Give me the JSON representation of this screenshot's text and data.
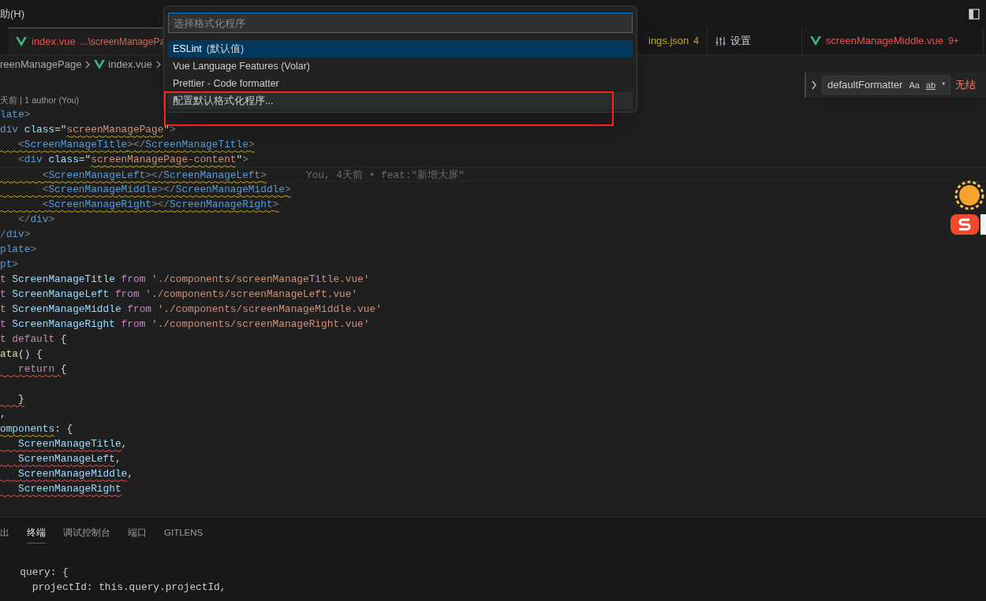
{
  "menu": {
    "label": "助(H)"
  },
  "tabs": [
    {
      "name": "index.vue",
      "path": "...\\screenManagePa",
      "kind": "vue",
      "color": "#f14c4c",
      "selected": true
    },
    {
      "name": "ings.json",
      "badge": "4",
      "kind": "json",
      "color": "#cca700",
      "selected": false
    },
    {
      "name": "设置",
      "kind": "settings",
      "color": "#cccccc",
      "selected": false
    },
    {
      "name": "screenManageMiddle.vue",
      "badge": "9+",
      "kind": "vue",
      "color": "#f14c4c",
      "selected": false
    }
  ],
  "breadcrumb": [
    {
      "label": "reenManagePage",
      "kind": "folder"
    },
    {
      "label": "index.vue",
      "kind": "vue"
    }
  ],
  "code_lens": "天前 | 1 author (You)",
  "code_lines": [
    {
      "kind": "code",
      "tokens": [
        {
          "kind": "tag",
          "text": "late"
        },
        {
          "kind": "punct",
          "text": ">"
        }
      ]
    },
    {
      "kind": "code",
      "tokens": [
        {
          "kind": "tag",
          "text": "div"
        },
        {
          "kind": "attr",
          "text": " class"
        },
        {
          "kind": "plain",
          "text": "=\""
        },
        {
          "kind": "string",
          "text": "screenManagePage",
          "color": "#cca700"
        },
        {
          "kind": "plain",
          "text": "\""
        },
        {
          "kind": "punct",
          "text": ">"
        }
      ]
    },
    {
      "kind": "code",
      "tokens": [
        {
          "kind": "punct",
          "text": "   <",
          "color": "#cca700"
        },
        {
          "kind": "tag",
          "text": "ScreenManageTitle",
          "color": "#cca700"
        },
        {
          "kind": "punct",
          "text": "></",
          "color": "#cca700"
        },
        {
          "kind": "tag",
          "text": "ScreenManageTitle",
          "color": "#cca700"
        },
        {
          "kind": "punct",
          "text": ">",
          "color": "#cca700"
        }
      ]
    },
    {
      "kind": "code",
      "tokens": [
        {
          "kind": "punct",
          "text": "   <"
        },
        {
          "kind": "tag",
          "text": "div"
        },
        {
          "kind": "attr",
          "text": " class"
        },
        {
          "kind": "plain",
          "text": "=\""
        },
        {
          "kind": "string",
          "text": "screenManagePage-content",
          "color": "#cca700"
        },
        {
          "kind": "plain",
          "text": "\""
        },
        {
          "kind": "punct",
          "text": ">"
        }
      ]
    },
    {
      "kind": "code",
      "blame": "You, 4天前 • feat:\"新增大屏\"",
      "tokens": [
        {
          "kind": "punct",
          "text": "       <",
          "color": "#cca700"
        },
        {
          "kind": "tag",
          "text": "ScreenManageLeft",
          "color": "#cca700"
        },
        {
          "kind": "punct",
          "text": "></",
          "color": "#cca700"
        },
        {
          "kind": "tag",
          "text": "ScreenManageLeft",
          "color": "#cca700"
        },
        {
          "kind": "punct",
          "text": ">",
          "color": "#cca700"
        }
      ]
    },
    {
      "kind": "code",
      "tokens": [
        {
          "kind": "punct",
          "text": "       <",
          "color": "#cca700"
        },
        {
          "kind": "tag",
          "text": "ScreenManageMiddle",
          "color": "#cca700"
        },
        {
          "kind": "punct",
          "text": "></",
          "color": "#cca700"
        },
        {
          "kind": "tag",
          "text": "ScreenManageMiddle",
          "color": "#cca700"
        },
        {
          "kind": "punct",
          "text": ">",
          "color": "#cca700"
        }
      ]
    },
    {
      "kind": "code",
      "tokens": [
        {
          "kind": "punct",
          "text": "       <",
          "color": "#cca700"
        },
        {
          "kind": "tag",
          "text": "ScreenManageRight",
          "color": "#cca700"
        },
        {
          "kind": "punct",
          "text": "></",
          "color": "#cca700"
        },
        {
          "kind": "tag",
          "text": "ScreenManageRight",
          "color": "#cca700"
        },
        {
          "kind": "punct",
          "text": ">",
          "color": "#cca700"
        }
      ]
    },
    {
      "kind": "code",
      "tokens": [
        {
          "kind": "punct",
          "text": "   </"
        },
        {
          "kind": "tag",
          "text": "div"
        },
        {
          "kind": "punct",
          "text": ">"
        }
      ]
    },
    {
      "kind": "code",
      "tokens": [
        {
          "kind": "punct",
          "text": "/"
        },
        {
          "kind": "tag",
          "text": "div"
        },
        {
          "kind": "punct",
          "text": ">"
        }
      ]
    },
    {
      "kind": "code",
      "tokens": [
        {
          "kind": "tag",
          "text": "plate"
        },
        {
          "kind": "punct",
          "text": ">"
        }
      ]
    },
    {
      "kind": "code",
      "tokens": [
        {
          "kind": "tag",
          "text": "pt"
        },
        {
          "kind": "punct",
          "text": ">"
        }
      ]
    },
    {
      "kind": "code",
      "tokens": [
        {
          "kind": "keyword",
          "text": "t "
        },
        {
          "kind": "ident",
          "text": "ScreenManageTitle "
        },
        {
          "kind": "keyword",
          "text": "from "
        },
        {
          "kind": "string",
          "text": "'./components/screenManageTitle.vue'"
        }
      ]
    },
    {
      "kind": "code",
      "tokens": [
        {
          "kind": "keyword",
          "text": "t "
        },
        {
          "kind": "ident",
          "text": "ScreenManageLeft "
        },
        {
          "kind": "keyword",
          "text": "from "
        },
        {
          "kind": "string",
          "text": "'./components/screenManageLeft.vue'"
        }
      ]
    },
    {
      "kind": "code",
      "tokens": [
        {
          "kind": "keyword",
          "text": "t "
        },
        {
          "kind": "ident",
          "text": "ScreenManageMiddle "
        },
        {
          "kind": "keyword",
          "text": "from "
        },
        {
          "kind": "string",
          "text": "'./components/screenManageMiddle.vue'"
        }
      ]
    },
    {
      "kind": "code",
      "tokens": [
        {
          "kind": "keyword",
          "text": "t "
        },
        {
          "kind": "ident",
          "text": "ScreenManageRight "
        },
        {
          "kind": "keyword",
          "text": "from "
        },
        {
          "kind": "string",
          "text": "'./components/screenManageRight.vue'"
        }
      ]
    },
    {
      "kind": "code",
      "tokens": [
        {
          "kind": "keyword",
          "text": "t default "
        },
        {
          "kind": "plain",
          "text": "{"
        }
      ]
    },
    {
      "kind": "code",
      "tokens": [
        {
          "kind": "func",
          "text": "ata"
        },
        {
          "kind": "plain",
          "text": "() {"
        }
      ]
    },
    {
      "kind": "code",
      "tokens": [
        {
          "kind": "keyword",
          "text": "   return ",
          "color": "#f14c4c"
        },
        {
          "kind": "plain",
          "text": "{"
        }
      ]
    },
    {
      "kind": "blank"
    },
    {
      "kind": "code",
      "tokens": [
        {
          "kind": "plain",
          "text": "   }",
          "color": "#f14c4c"
        }
      ]
    },
    {
      "kind": "code",
      "tokens": [
        {
          "kind": "plain",
          "text": ","
        }
      ]
    },
    {
      "kind": "code",
      "tokens": [
        {
          "kind": "ident",
          "text": "omponents",
          "color": "#cca700"
        },
        {
          "kind": "plain",
          "text": ": {"
        }
      ]
    },
    {
      "kind": "code",
      "tokens": [
        {
          "kind": "ident",
          "text": "   ScreenManageTitle",
          "color": "#f14c4c"
        },
        {
          "kind": "plain",
          "text": ","
        }
      ]
    },
    {
      "kind": "code",
      "tokens": [
        {
          "kind": "ident",
          "text": "   ScreenManageLeft",
          "color": "#f14c4c"
        },
        {
          "kind": "plain",
          "text": ","
        }
      ]
    },
    {
      "kind": "code",
      "tokens": [
        {
          "kind": "ident",
          "text": "   ScreenManageMiddle",
          "color": "#f14c4c"
        },
        {
          "kind": "plain",
          "text": ","
        }
      ]
    },
    {
      "kind": "code",
      "tokens": [
        {
          "kind": "ident",
          "text": "   ScreenManageRight",
          "color": "#f14c4c"
        }
      ]
    }
  ],
  "find_widget": {
    "value": "defaultFormatter",
    "options": [
      "Aa",
      "ab",
      "*"
    ],
    "result": "无结"
  },
  "quick_pick": {
    "placeholder": "选择格式化程序",
    "items": [
      {
        "label": "ESLint",
        "detail": "(默认值)",
        "selected": true
      },
      {
        "label": "Vue Language Features (Volar)",
        "selected": false
      },
      {
        "label": "Prettier - Code formatter",
        "selected": false
      },
      {
        "label": "配置默认格式化程序...",
        "selected": false
      }
    ]
  },
  "panel": {
    "tabs": [
      {
        "label": "出",
        "selected": false
      },
      {
        "label": "终端",
        "selected": true
      },
      {
        "label": "调试控制台",
        "selected": false
      },
      {
        "label": "端口",
        "selected": false
      },
      {
        "label": "GITLENS",
        "selected": false
      }
    ],
    "terminal_lines": [
      "  query: {",
      "    projectId: this.query.projectId,"
    ]
  }
}
